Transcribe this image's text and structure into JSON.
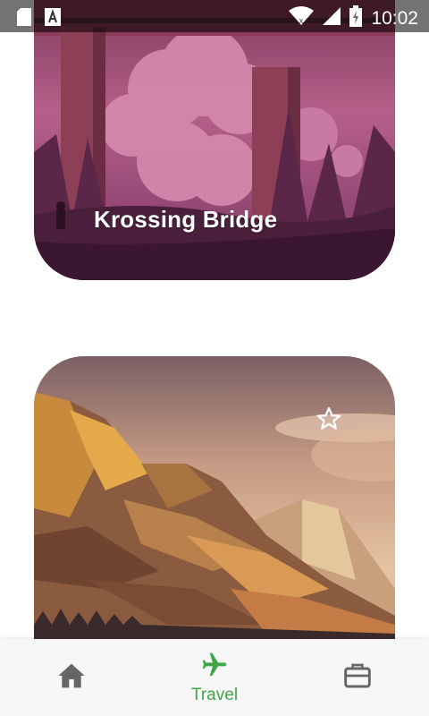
{
  "status_bar": {
    "time": "10:02",
    "icons": [
      "sd-card-icon",
      "text-notification-icon",
      "wifi-icon",
      "signal-icon",
      "battery-charging-icon"
    ]
  },
  "cards": [
    {
      "title": "Krossing Bridge",
      "illustration": "bridge-landscape"
    },
    {
      "title": "",
      "illustration": "mountain-landscape",
      "favorite_icon": "star-outline-icon"
    }
  ],
  "bottom_nav": {
    "items": [
      {
        "icon": "home-icon",
        "label": "",
        "active": false
      },
      {
        "icon": "airplane-icon",
        "label": "Travel",
        "active": true
      },
      {
        "icon": "briefcase-icon",
        "label": "",
        "active": false
      }
    ],
    "active_color": "#3fa64a",
    "inactive_color": "#666666"
  }
}
